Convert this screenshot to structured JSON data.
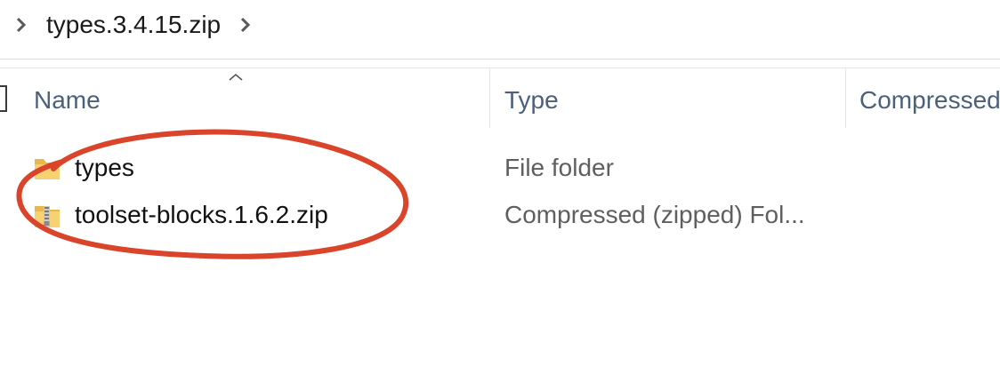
{
  "breadcrumb": {
    "current": "types.3.4.15.zip"
  },
  "columns": {
    "name": "Name",
    "type": "Type",
    "compressed": "Compressed"
  },
  "rows": [
    {
      "name": "types",
      "type": "File folder",
      "icon": "folder-icon"
    },
    {
      "name": "toolset-blocks.1.6.2.zip",
      "type": "Compressed (zipped) Fol...",
      "icon": "zip-folder-icon"
    }
  ],
  "colors": {
    "annotation": "#d9442b",
    "folder": "#f2c94c",
    "header_text": "#4c607a"
  }
}
